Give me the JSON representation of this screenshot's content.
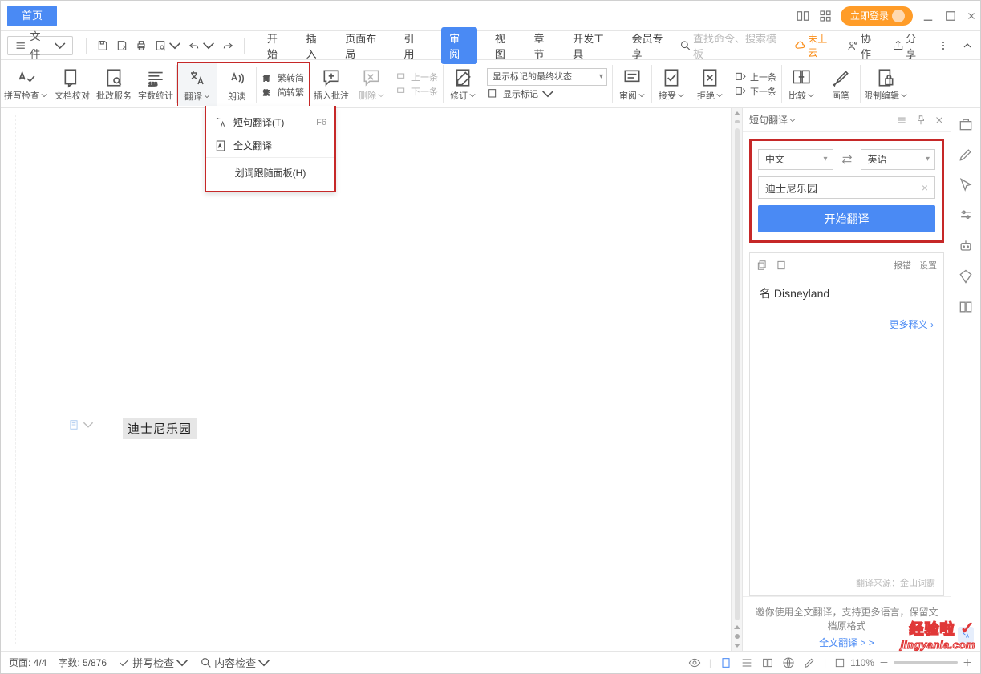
{
  "titlebar": {
    "home": "首页",
    "login": "立即登录"
  },
  "menubar": {
    "file": "文件",
    "tabs": [
      "开始",
      "插入",
      "页面布局",
      "引用",
      "审阅",
      "视图",
      "章节",
      "开发工具",
      "会员专享"
    ],
    "search_ph": "查找命令、搜索模板",
    "cloud": "未上云",
    "collab": "协作",
    "share": "分享"
  },
  "ribbon": {
    "spellcheck": "拼写检查",
    "compare": "文档校对",
    "approve": "批改服务",
    "wordcount": "字数统计",
    "translate": "翻译",
    "read": "朗读",
    "tc2sc": "繁转简",
    "sc2tc": "简转繁",
    "insert_comment": "插入批注",
    "delete": "删除",
    "prev": "上一条",
    "next": "下一条",
    "track": "修订",
    "show_markup": "显示标记",
    "markup_mode": "显示标记的最终状态",
    "review": "审阅",
    "accept": "接受",
    "reject": "拒绝",
    "nav_prev": "上一条",
    "nav_next": "下一条",
    "compare2": "比较",
    "brush": "画笔",
    "restrict": "限制编辑"
  },
  "dropdown": {
    "phrase": "短句翻译(T)",
    "phrase_key": "F6",
    "full": "全文翻译",
    "panel": "划词跟随面板(H)"
  },
  "doc_text": "迪士尼乐园",
  "panel": {
    "title": "短句翻译",
    "src_lang": "中文",
    "dst_lang": "英语",
    "input": "迪士尼乐园",
    "start": "开始翻译",
    "report": "报错",
    "settings": "设置",
    "result_prefix": "名",
    "result_text": "Disneyland",
    "more": "更多释义 ›",
    "source": "翻译来源：金山词霸",
    "invite": "邀你使用全文翻译，支持更多语言，保留文档原格式",
    "invite_link": "全文翻译 > >"
  },
  "statusbar": {
    "page": "页面: 4/4",
    "words": "字数: 5/876",
    "spell": "拼写检查",
    "content": "内容检查",
    "zoom": "110%"
  },
  "watermark": {
    "top": "经验啦",
    "bot": "jingyanla.com"
  }
}
